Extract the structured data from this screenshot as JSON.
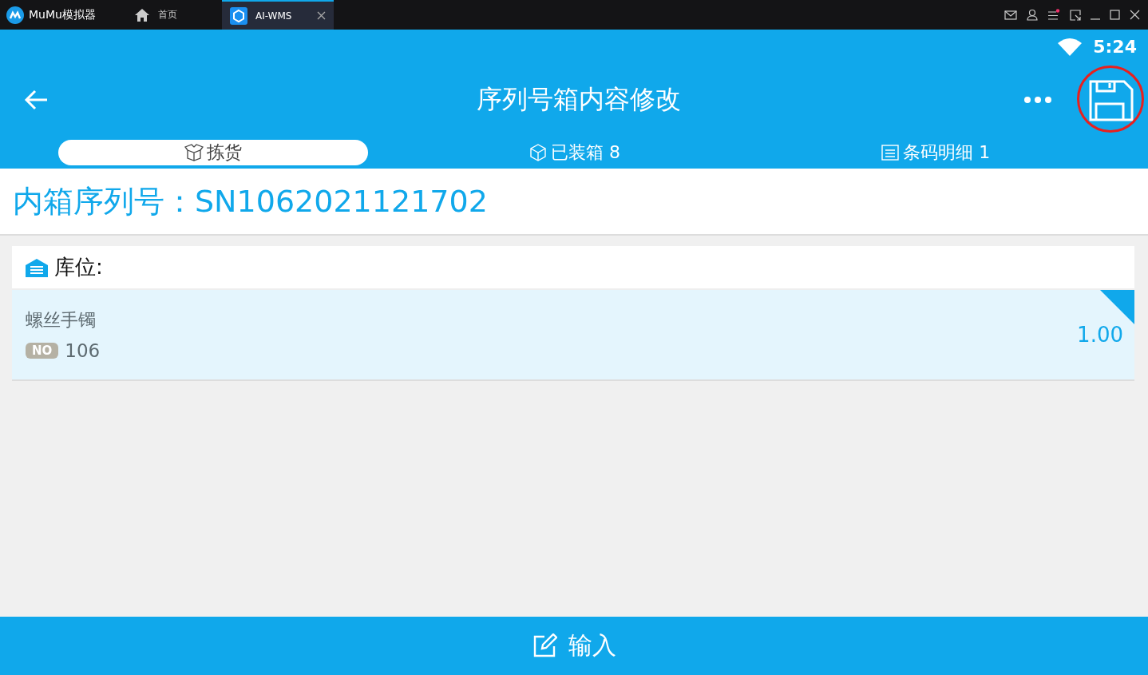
{
  "emulator": {
    "app_name": "MuMu模拟器",
    "tabs": [
      {
        "label": "首页",
        "kind": "home",
        "selected": false
      },
      {
        "label": "AI-WMS",
        "kind": "app",
        "selected": true
      }
    ],
    "notification_dot": true
  },
  "status_bar": {
    "time": "5:24"
  },
  "toolbar": {
    "title": "序列号箱内容修改",
    "save_highlighted": true
  },
  "tabs": [
    {
      "label": "拣货",
      "kind": "box-open",
      "selected": true
    },
    {
      "label": "已装箱 8",
      "kind": "box",
      "selected": false
    },
    {
      "label": "条码明细 1",
      "kind": "list",
      "selected": false
    }
  ],
  "serial": {
    "label": "内箱序列号：",
    "value": "SN1062021121702"
  },
  "location": {
    "label": "库位:"
  },
  "items": [
    {
      "name": "螺丝手镯",
      "badge": "NO",
      "number": "106",
      "quantity": "1.00",
      "flagged": true
    }
  ],
  "bottom_button": {
    "label": "输入"
  }
}
